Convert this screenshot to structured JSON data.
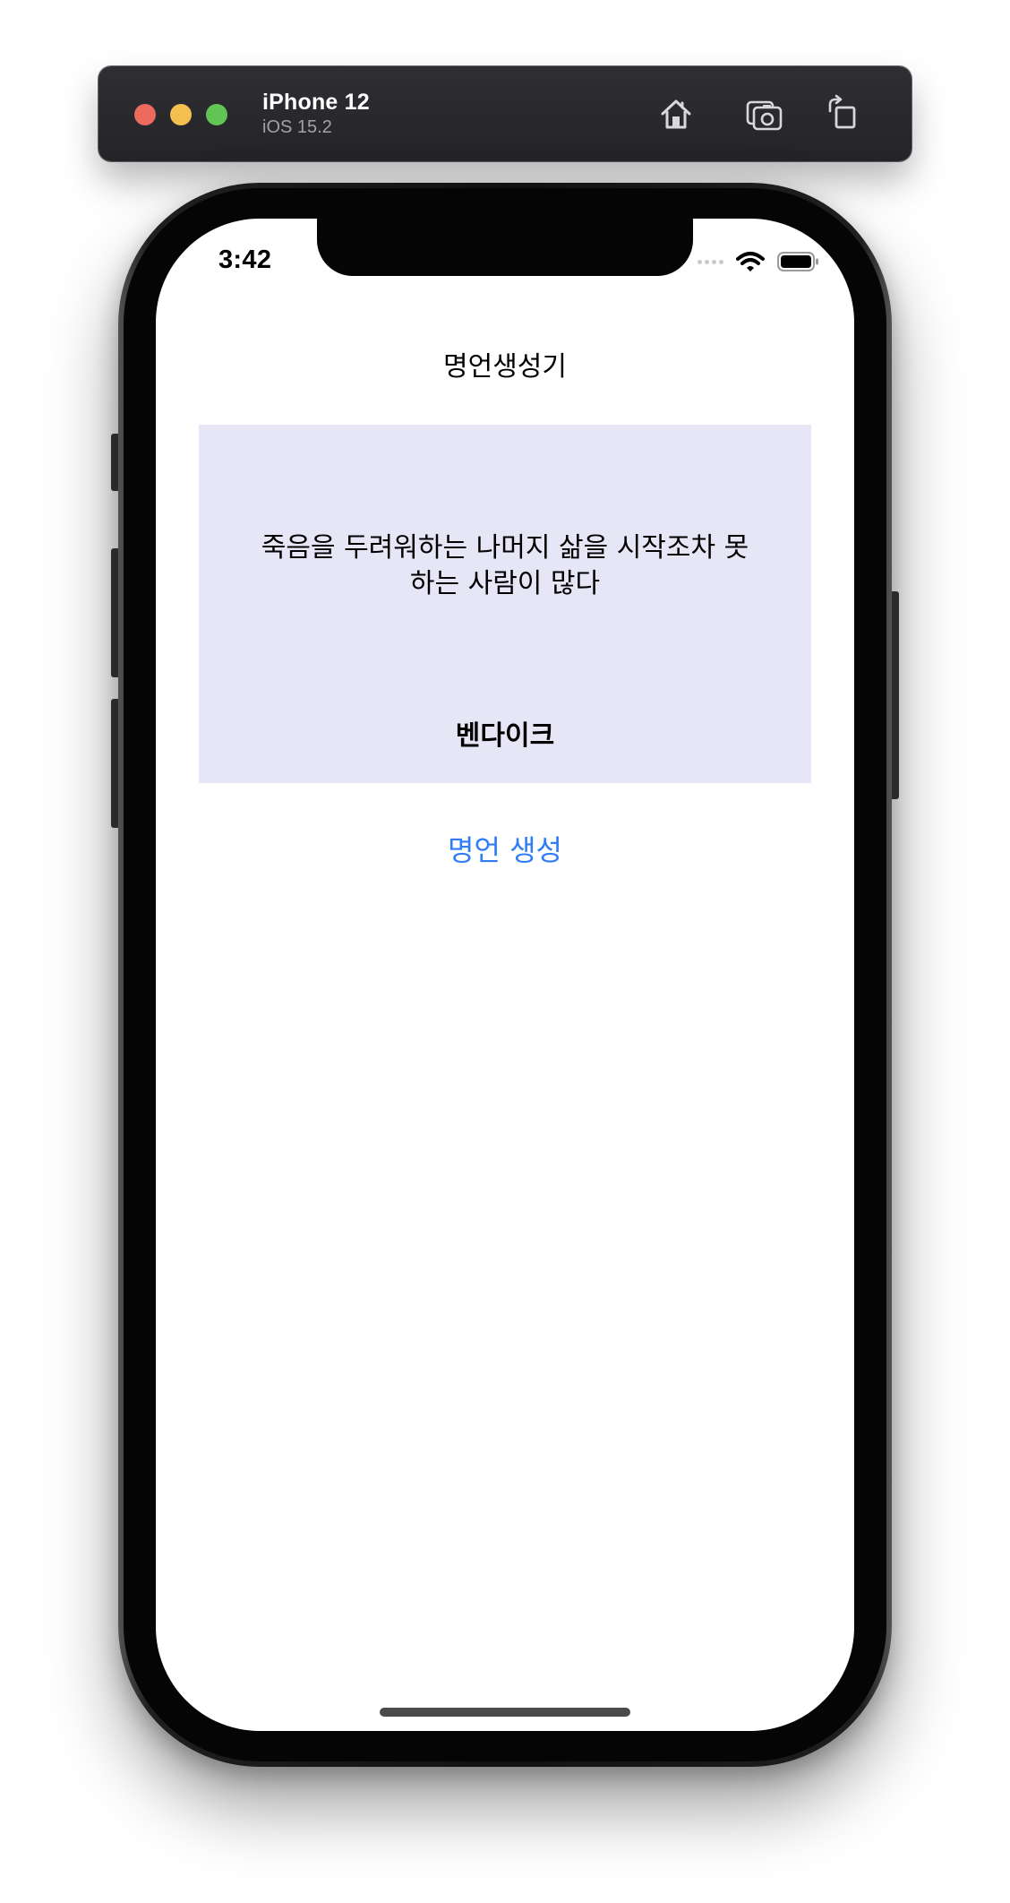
{
  "simulator": {
    "device_name": "iPhone 12",
    "os_version": "iOS 15.2",
    "buttons": {
      "home_icon": "home-icon",
      "screenshot_icon": "screenshot-icon",
      "rotate_icon": "rotate-icon"
    }
  },
  "status_bar": {
    "time": "3:42",
    "icons": [
      "signal-dots-icon",
      "wifi-icon",
      "battery-icon"
    ]
  },
  "app": {
    "nav_title": "명언생성기",
    "quote": {
      "text": "죽음을 두려워하는 나머지 삶을 시작조차 못하는 사람이 많다",
      "author": "벤다이크"
    },
    "generate_button_label": "명언 생성"
  },
  "colors": {
    "quote_card_bg": "#e6e6f6",
    "button_tint": "#2f7df6",
    "toolbar_bg": "#2a2a2e"
  }
}
